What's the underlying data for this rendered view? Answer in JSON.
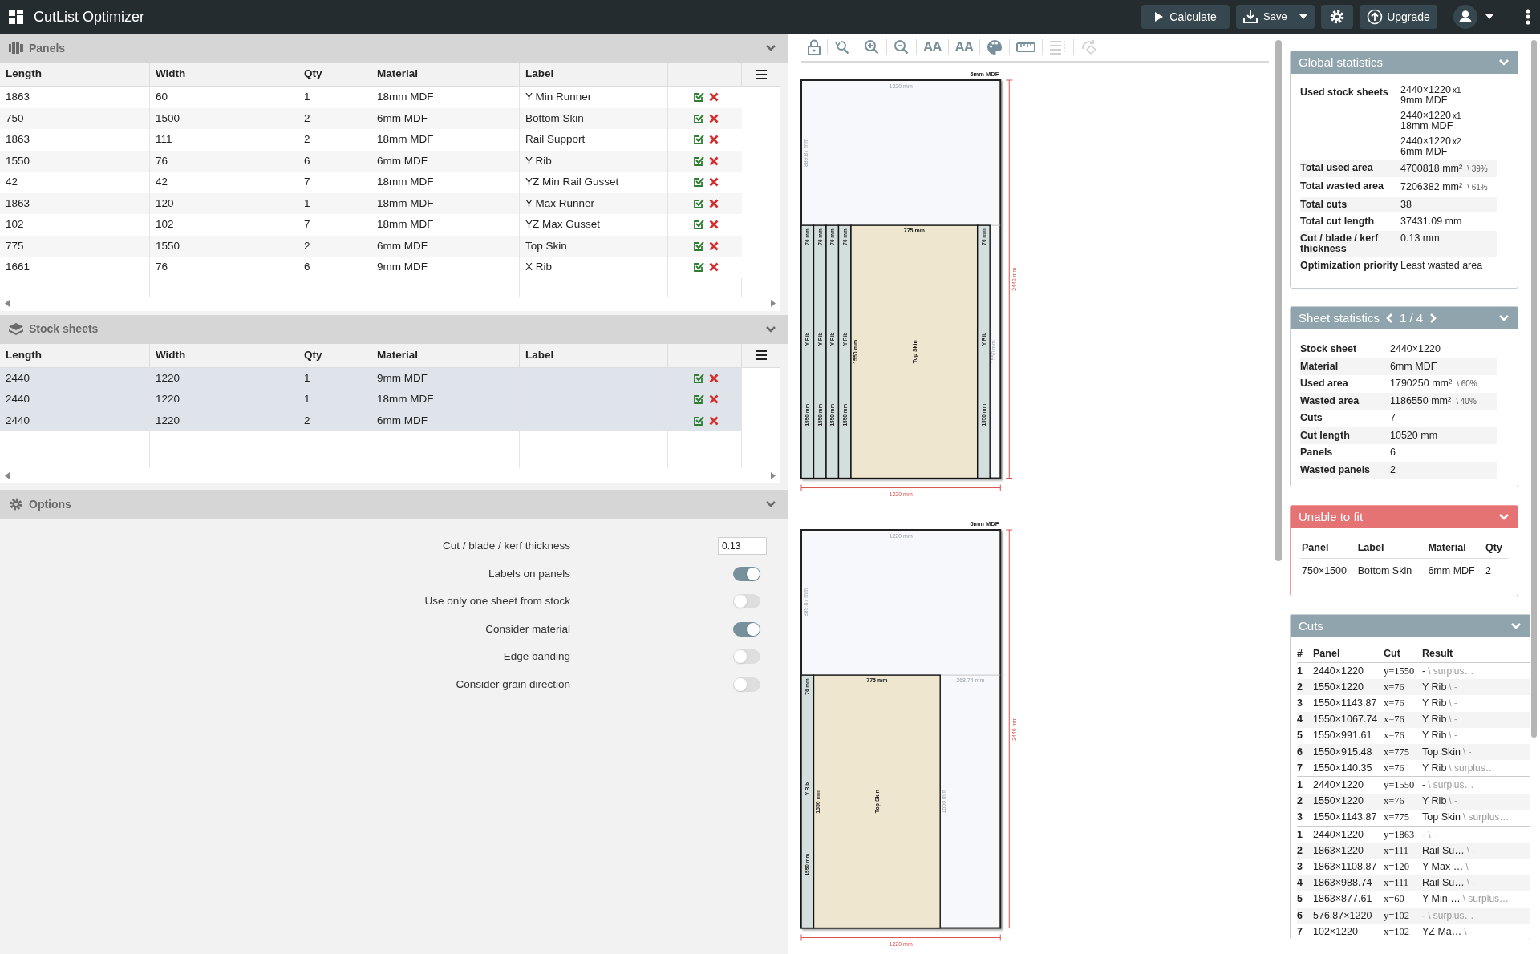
{
  "app": {
    "title": "CutList Optimizer"
  },
  "actions": [
    {
      "kind": "calculate",
      "label": "Calculate"
    },
    {
      "kind": "save",
      "label": "Save"
    },
    {
      "kind": "settings"
    },
    {
      "kind": "upgrade",
      "label": "Upgrade"
    },
    {
      "kind": "account"
    },
    {
      "kind": "more"
    }
  ],
  "panels": {
    "title": "Panels",
    "expanded": true,
    "columns": [
      "Length",
      "Width",
      "Qty",
      "Material",
      "Label"
    ],
    "rows": [
      {
        "cells": [
          "1863",
          "60",
          "1",
          "18mm MDF",
          "Y Min Runner"
        ],
        "selected": false
      },
      {
        "cells": [
          "750",
          "1500",
          "2",
          "6mm MDF",
          "Bottom Skin"
        ],
        "selected": false
      },
      {
        "cells": [
          "1863",
          "111",
          "2",
          "18mm MDF",
          "Rail Support"
        ],
        "selected": false
      },
      {
        "cells": [
          "1550",
          "76",
          "6",
          "6mm MDF",
          "Y Rib"
        ],
        "selected": false
      },
      {
        "cells": [
          "42",
          "42",
          "7",
          "18mm MDF",
          "YZ Min Rail Gusset"
        ],
        "selected": false
      },
      {
        "cells": [
          "1863",
          "120",
          "1",
          "18mm MDF",
          "Y Max Runner"
        ],
        "selected": false
      },
      {
        "cells": [
          "102",
          "102",
          "7",
          "18mm MDF",
          "YZ Max Gusset"
        ],
        "selected": false
      },
      {
        "cells": [
          "775",
          "1550",
          "2",
          "6mm MDF",
          "Top Skin"
        ],
        "selected": false
      },
      {
        "cells": [
          "1661",
          "76",
          "6",
          "9mm MDF",
          "X Rib"
        ],
        "selected": false
      }
    ]
  },
  "stock_sheets": {
    "title": "Stock sheets",
    "expanded": true,
    "columns": [
      "Length",
      "Width",
      "Qty",
      "Material",
      "Label"
    ],
    "rows": [
      {
        "cells": [
          "2440",
          "1220",
          "1",
          "9mm MDF"
        ],
        "selected": true
      },
      {
        "cells": [
          "2440",
          "1220",
          "1",
          "18mm MDF"
        ],
        "selected": true
      },
      {
        "cells": [
          "2440",
          "1220",
          "2",
          "6mm MDF"
        ],
        "selected": true
      }
    ]
  },
  "options": {
    "title": "Options",
    "expanded": true,
    "items": [
      {
        "kind": "number",
        "label": "Cut / blade / kerf thickness",
        "value": "0.13"
      },
      {
        "kind": "toggle",
        "label": "Labels on panels",
        "on": true
      },
      {
        "kind": "toggle",
        "label": "Use only one sheet from stock",
        "on": false
      },
      {
        "kind": "toggle",
        "label": "Consider material",
        "on": true
      },
      {
        "kind": "toggle",
        "label": "Edge banding",
        "on": false
      },
      {
        "kind": "toggle",
        "label": "Consider grain direction",
        "on": false
      }
    ]
  },
  "canvas_tools": [
    {
      "kind": "lock",
      "disabled": false
    },
    {
      "kind": "zoom_reset",
      "disabled": false
    },
    {
      "kind": "zoom_in",
      "disabled": false
    },
    {
      "kind": "zoom_out",
      "disabled": false
    },
    {
      "kind": "font_up",
      "label": "AA",
      "disabled": false
    },
    {
      "kind": "font_down",
      "label": "AA",
      "disabled": false
    },
    {
      "kind": "palette",
      "disabled": false
    },
    {
      "kind": "ruler",
      "disabled": false
    },
    {
      "kind": "list",
      "disabled": true
    },
    {
      "kind": "rotate",
      "disabled": true
    }
  ],
  "sheets": [
    {
      "material": "6mm MDF",
      "top_width": "1220 mm",
      "top_height": "889.87 mm",
      "width_dim": "1220 mm",
      "height_dim": "2440 mm",
      "pieces": [
        {
          "kind": "panel",
          "label": "Y Rib",
          "width": "76 mm",
          "length": "1550 mm",
          "color": "#d3dfdc"
        },
        {
          "kind": "panel",
          "label": "Y Rib",
          "width": "76 mm",
          "length": "1550 mm",
          "color": "#d3dfdc"
        },
        {
          "kind": "panel",
          "label": "Y Rib",
          "width": "76 mm",
          "length": "1550 mm",
          "color": "#d3dfdc"
        },
        {
          "kind": "panel",
          "label": "Y Rib",
          "width": "76 mm",
          "length": "1550 mm",
          "color": "#d3dfdc"
        },
        {
          "kind": "panel",
          "label": "Top Skin",
          "width": "775 mm",
          "length": "1550 mm",
          "color": "#efe6cf"
        },
        {
          "kind": "panel",
          "label": "Y Rib",
          "width": "76 mm",
          "length": "1550 mm",
          "color": "#d3dfdc"
        },
        {
          "kind": "waste",
          "length": "1550 mm"
        }
      ]
    },
    {
      "material": "6mm MDF",
      "top_width": "1220 mm",
      "top_height": "889.87 mm",
      "width_dim": "1220 mm",
      "height_dim": "2440 mm",
      "pieces": [
        {
          "kind": "panel",
          "label": "Y Rib",
          "width": "76 mm",
          "length": "1550 mm",
          "color": "#d3dfdc"
        },
        {
          "kind": "panel",
          "label": "Top Skin",
          "width": "775 mm",
          "length": "1550 mm",
          "color": "#efe6cf"
        },
        {
          "kind": "waste",
          "width": "368.74 mm",
          "length": "1550 mm"
        }
      ]
    }
  ],
  "global_statistics": {
    "title": "Global statistics",
    "rows": [
      {
        "kind": "sheets",
        "label": "Used stock sheets",
        "sheets": [
          {
            "size": "2440×1220",
            "count": "x1",
            "material": "9mm MDF"
          },
          {
            "size": "2440×1220",
            "count": "x1",
            "material": "18mm MDF"
          },
          {
            "size": "2440×1220",
            "count": "x2",
            "material": "6mm MDF"
          }
        ]
      },
      {
        "kind": "value",
        "label": "Total used area",
        "value": "4700818 mm²",
        "share": "\\ 39%"
      },
      {
        "kind": "value",
        "label": "Total wasted area",
        "value": "7206382 mm²",
        "share": "\\ 61%"
      },
      {
        "kind": "value",
        "label": "Total cuts",
        "value": "38"
      },
      {
        "kind": "value",
        "label": "Total cut length",
        "value": "37431.09 mm"
      },
      {
        "kind": "value",
        "label": "Cut / blade / kerf thickness",
        "value": "0.13 mm"
      },
      {
        "kind": "value",
        "label": "Optimization priority",
        "value": "Least wasted area"
      }
    ]
  },
  "sheet_statistics": {
    "title": "Sheet statistics",
    "page": "1 / 4",
    "rows": [
      {
        "label": "Stock sheet",
        "value": "2440×1220"
      },
      {
        "label": "Material",
        "value": "6mm MDF"
      },
      {
        "label": "Used area",
        "value": "1790250 mm²",
        "share": "\\ 60%"
      },
      {
        "label": "Wasted area",
        "value": "1186550 mm²",
        "share": "\\ 40%"
      },
      {
        "label": "Cuts",
        "value": "7"
      },
      {
        "label": "Cut length",
        "value": "10520 mm"
      },
      {
        "label": "Panels",
        "value": "6"
      },
      {
        "label": "Wasted panels",
        "value": "2"
      }
    ]
  },
  "unable_to_fit": {
    "title": "Unable to fit",
    "columns": [
      "Panel",
      "Label",
      "Material",
      "Qty"
    ],
    "rows": [
      [
        "750×1500",
        "Bottom Skin",
        "6mm MDF",
        "2"
      ]
    ]
  },
  "cuts": {
    "title": "Cuts",
    "columns": [
      "#",
      "Panel",
      "Cut",
      "Result"
    ],
    "groups": [
      [
        {
          "n": "1",
          "panel": "2440×1220",
          "cut": "y=1550",
          "result": "-",
          "rest": "\\ surplus…"
        },
        {
          "n": "2",
          "panel": "1550×1220",
          "cut": "x=76",
          "result": "Y Rib",
          "rest": "\\ -"
        },
        {
          "n": "3",
          "panel": "1550×1143.87",
          "cut": "x=76",
          "result": "Y Rib",
          "rest": "\\ -"
        },
        {
          "n": "4",
          "panel": "1550×1067.74",
          "cut": "x=76",
          "result": "Y Rib",
          "rest": "\\ -"
        },
        {
          "n": "5",
          "panel": "1550×991.61",
          "cut": "x=76",
          "result": "Y Rib",
          "rest": "\\ -"
        },
        {
          "n": "6",
          "panel": "1550×915.48",
          "cut": "x=775",
          "result": "Top Skin",
          "rest": "\\ -"
        },
        {
          "n": "7",
          "panel": "1550×140.35",
          "cut": "x=76",
          "result": "Y Rib",
          "rest": "\\ surplus…"
        }
      ],
      [
        {
          "n": "1",
          "panel": "2440×1220",
          "cut": "y=1550",
          "result": "-",
          "rest": "\\ surplus…"
        },
        {
          "n": "2",
          "panel": "1550×1220",
          "cut": "x=76",
          "result": "Y Rib",
          "rest": "\\ -"
        },
        {
          "n": "3",
          "panel": "1550×1143.87",
          "cut": "x=775",
          "result": "Top Skin",
          "rest": "\\ surplus…"
        }
      ],
      [
        {
          "n": "1",
          "panel": "2440×1220",
          "cut": "y=1863",
          "result": "-",
          "rest": "\\ -"
        },
        {
          "n": "2",
          "panel": "1863×1220",
          "cut": "x=111",
          "result": "Rail Su…",
          "rest": "\\ -"
        },
        {
          "n": "3",
          "panel": "1863×1108.87",
          "cut": "x=120",
          "result": "Y Max …",
          "rest": "\\ -"
        },
        {
          "n": "4",
          "panel": "1863×988.74",
          "cut": "x=111",
          "result": "Rail Su…",
          "rest": "\\ -"
        },
        {
          "n": "5",
          "panel": "1863×877.61",
          "cut": "x=60",
          "result": "Y Min …",
          "rest": "\\ surplus…"
        },
        {
          "n": "6",
          "panel": "576.87×1220",
          "cut": "y=102",
          "result": "-",
          "rest": "\\ surplus…"
        },
        {
          "n": "7",
          "panel": "102×1220",
          "cut": "x=102",
          "result": "YZ Ma…",
          "rest": "\\ -"
        }
      ]
    ]
  }
}
